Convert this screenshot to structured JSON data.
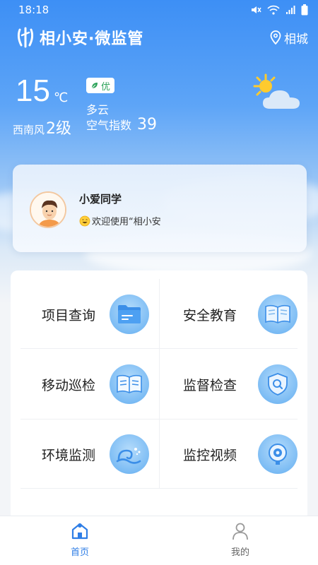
{
  "status_bar": {
    "time": "18:18"
  },
  "header": {
    "app_title": "相小安·微监管",
    "location": "相城"
  },
  "weather": {
    "temperature": "15",
    "unit": "℃",
    "wind_direction": "西南风",
    "wind_level": "2级",
    "air_quality_badge": "优",
    "condition": "多云",
    "air_index_label": "空气指数",
    "air_index_value": "39"
  },
  "welcome": {
    "name": "小爱同学",
    "message": "欢迎使用“相小安"
  },
  "menu": {
    "items": [
      {
        "label": "项目查询",
        "icon": "folder-icon"
      },
      {
        "label": "安全教育",
        "icon": "book-icon"
      },
      {
        "label": "移动巡检",
        "icon": "open-book-icon"
      },
      {
        "label": "监督检查",
        "icon": "shield-search-icon"
      },
      {
        "label": "环境监测",
        "icon": "wave-icon"
      },
      {
        "label": "监控视频",
        "icon": "camera-icon"
      }
    ]
  },
  "bottom_nav": {
    "home_label": "首页",
    "mine_label": "我的",
    "active_color": "#2f7ee6",
    "inactive_color": "#666666"
  }
}
